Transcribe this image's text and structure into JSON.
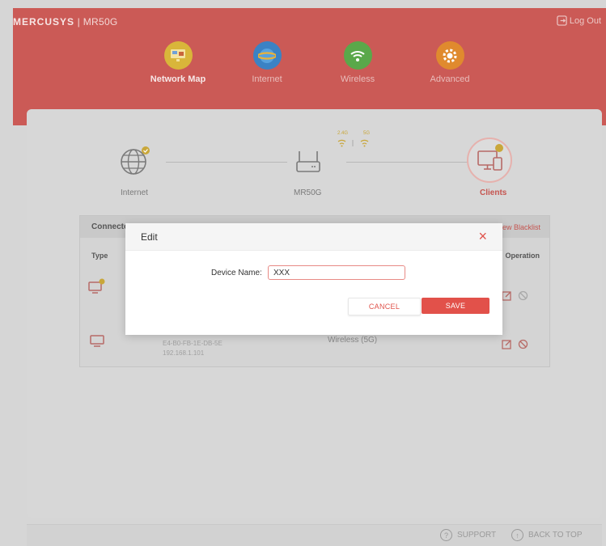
{
  "header": {
    "brand": "MERCUSYS",
    "model": "MR50G",
    "logout_label": "Log Out",
    "nav": [
      {
        "label": "Network Map",
        "icon": "network-map-icon",
        "active": true
      },
      {
        "label": "Internet",
        "icon": "globe-icon",
        "active": false
      },
      {
        "label": "Wireless",
        "icon": "wifi-icon",
        "active": false
      },
      {
        "label": "Advanced",
        "icon": "gear-icon",
        "active": false
      }
    ]
  },
  "map": {
    "internet_label": "Internet",
    "router_label": "MR50G",
    "clients_label": "Clients",
    "band_24": "2.4G",
    "band_5": "5G"
  },
  "clients_panel": {
    "title": "Connected Devices",
    "blacklist_link": "View Blacklist",
    "col_type": "Type",
    "col_operation": "Operation",
    "row2": {
      "mac": "E4-B0-FB-1E-DB-5E",
      "ip": "192.168.1.101",
      "connection": "Wireless (5G)"
    }
  },
  "modal": {
    "title": "Edit",
    "device_name_label": "Device Name:",
    "device_name_value": "XXX",
    "cancel_label": "CANCEL",
    "save_label": "SAVE"
  },
  "footer": {
    "support_label": "SUPPORT",
    "back_to_top_label": "BACK TO TOP"
  },
  "colors": {
    "brand_red": "#cb5a56",
    "accent_red": "#e2514a",
    "nav_yellow": "#d9b63a",
    "nav_blue": "#3b82c4",
    "nav_green": "#5aa84a",
    "nav_orange": "#e08a2e"
  }
}
